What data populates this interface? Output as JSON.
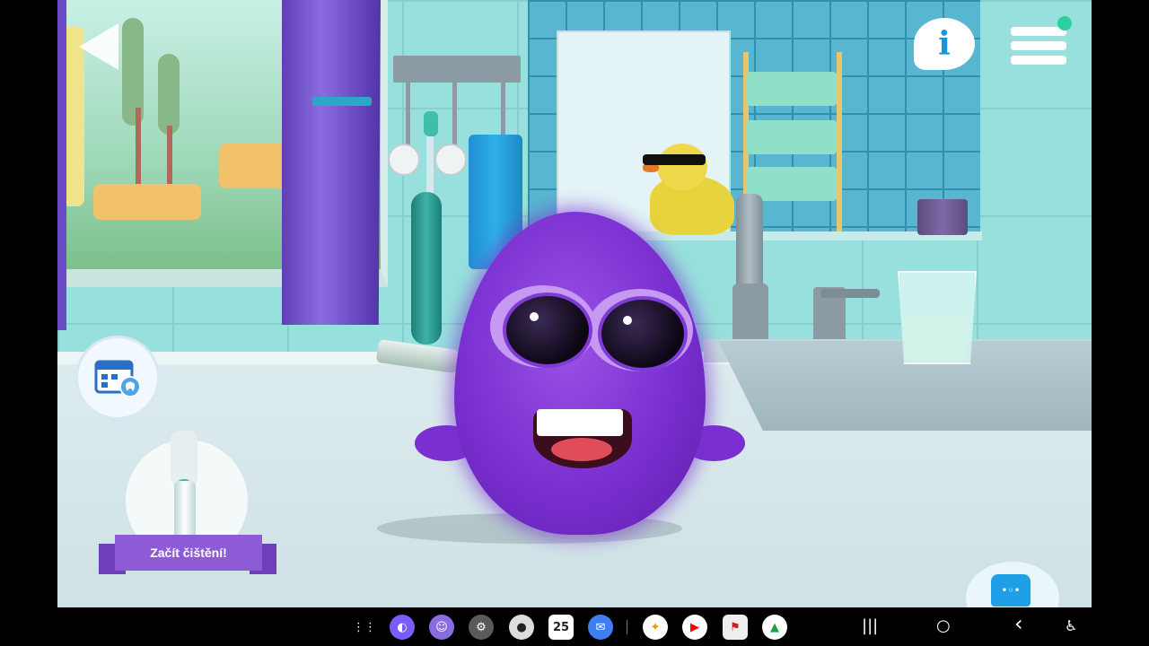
{
  "game": {
    "start_brushing_label": "Začít čištění!",
    "info_label": "i"
  },
  "taskbar": {
    "apps": [
      {
        "name": "app-drawer-icon",
        "glyph": "⋮⋮"
      },
      {
        "name": "internet-icon",
        "glyph": "◐",
        "color": "#7b5cff"
      },
      {
        "name": "kids-app-icon",
        "glyph": "☺",
        "color": "#8a6de0"
      },
      {
        "name": "settings-icon",
        "glyph": "⚙",
        "color": "#7a7a7a"
      },
      {
        "name": "camera-icon",
        "glyph": "●",
        "color": "#dddddd"
      },
      {
        "name": "calendar-icon",
        "glyph": "25",
        "color": "#ffffff"
      },
      {
        "name": "messages-icon",
        "glyph": "✉",
        "color": "#3d7ff0"
      },
      {
        "name": "photos-icon",
        "glyph": "✦",
        "color": "#ffffff"
      },
      {
        "name": "youtube-icon",
        "glyph": "▶",
        "color": "#ff0000"
      },
      {
        "name": "racing-app-icon",
        "glyph": "⚑",
        "color": "#cc2020"
      },
      {
        "name": "drive-icon",
        "glyph": "▲",
        "color": "#ffffff"
      }
    ],
    "nav": {
      "recents": "|||",
      "home": "○",
      "back": "‹",
      "accessibility": "♿"
    }
  }
}
